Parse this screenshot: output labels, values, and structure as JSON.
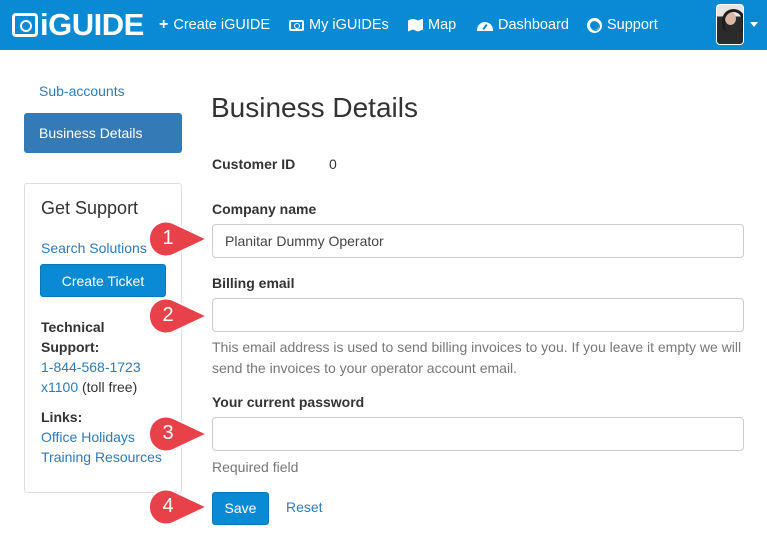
{
  "navbar": {
    "logo_text": "iGUIDE",
    "items": [
      {
        "label": "Create iGUIDE",
        "icon": "plus-icon"
      },
      {
        "label": "My iGUIDEs",
        "icon": "camera-icon"
      },
      {
        "label": "Map",
        "icon": "map-icon"
      },
      {
        "label": "Dashboard",
        "icon": "dashboard-icon"
      },
      {
        "label": "Support",
        "icon": "lifebuoy-icon"
      }
    ],
    "brand_color": "#0a8ad2"
  },
  "sidebar": {
    "items": [
      {
        "label": "Sub-accounts"
      },
      {
        "label": "Business Details",
        "active": true
      }
    ],
    "support": {
      "title": "Get Support",
      "search_link": "Search Solutions",
      "ticket_button": "Create Ticket",
      "tech_label_1": "Technical",
      "tech_label_2": "Support:",
      "phone": "1-844-568-1723",
      "ext": "x1100",
      "toll_free": " (toll free)",
      "links_label": "Links:",
      "links": [
        "Office Holidays",
        "Training Resources"
      ]
    }
  },
  "main": {
    "title": "Business Details",
    "customer_id_label": "Customer ID",
    "customer_id_value": "0",
    "company_label": "Company name",
    "company_value": "Planitar Dummy Operator",
    "billing_label": "Billing email",
    "billing_value": "",
    "billing_help_1": "This email address is used to send billing invoices to you. If you leave it empty we will",
    "billing_help_2": "send the invoices to your operator account email.",
    "password_label": "Your current password",
    "password_value": "",
    "password_help": "Required field",
    "save_label": "Save",
    "reset_label": "Reset"
  },
  "markers": [
    "1",
    "2",
    "3",
    "4"
  ],
  "marker_color": "#e8414a"
}
